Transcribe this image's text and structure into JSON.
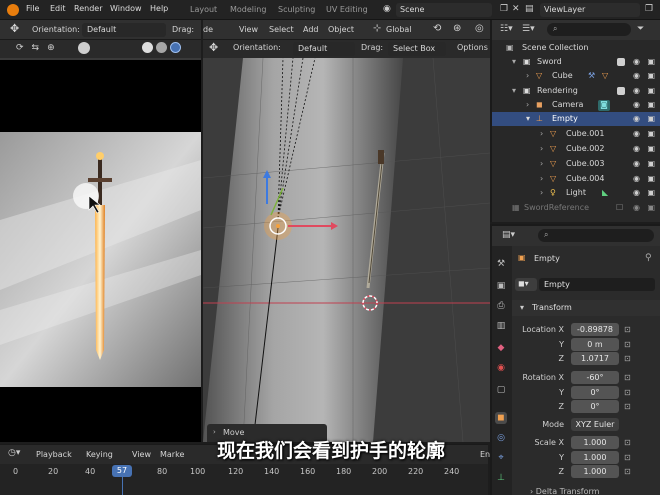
{
  "menu": {
    "file": "File",
    "edit": "Edit",
    "render": "Render",
    "window": "Window",
    "help": "Help"
  },
  "workspace_tabs": {
    "layout": "Layout",
    "modeling": "Modeling",
    "sculpting": "Sculpting",
    "uv_editing": "UV Editing"
  },
  "scene_field": "Scene",
  "view_layer_field": "ViewLayer",
  "left_viewport": {
    "orientation_label": "Orientation:",
    "orientation_value": "Default",
    "drag_label": "Drag:",
    "drag_value_partial": "Se"
  },
  "main_viewport": {
    "mode_partial": "de",
    "view": "View",
    "select": "Select",
    "add": "Add",
    "object": "Object",
    "transform_orientation": "Global",
    "orientation_label": "Orientation:",
    "orientation_value": "Default",
    "drag_label": "Drag:",
    "drag_value": "Select Box",
    "options": "Options",
    "move_panel": "Move"
  },
  "outliner": {
    "items": [
      {
        "label": "Scene Collection"
      },
      {
        "label": "Sword"
      },
      {
        "label": "Cube"
      },
      {
        "label": "Rendering"
      },
      {
        "label": "Camera"
      },
      {
        "label": "Empty"
      },
      {
        "label": "Cube.001"
      },
      {
        "label": "Cube.002"
      },
      {
        "label": "Cube.003"
      },
      {
        "label": "Cube.004"
      },
      {
        "label": "Light"
      },
      {
        "label": "SwordReference"
      }
    ]
  },
  "properties": {
    "object_name_header": "Empty",
    "object_name_field": "Empty",
    "transform_title": "Transform",
    "location_label": "Location X",
    "location": [
      "-0.89878",
      "0 m",
      "1.0717"
    ],
    "rotation_label": "Rotation X",
    "rotation": [
      "-60°",
      "0°",
      "0°"
    ],
    "y_label": "Y",
    "z_label": "Z",
    "mode_label": "Mode",
    "mode_value": "XYZ Euler",
    "scale_label": "Scale X",
    "scale": [
      "1.000",
      "1.000",
      "1.000"
    ],
    "delta_transform": "Delta Transform"
  },
  "timeline": {
    "playback": "Playback",
    "keying": "Keying",
    "view": "View",
    "marker_partial": "Marke",
    "end_partial": "En",
    "current_frame": "57",
    "ticks": [
      "0",
      "20",
      "40",
      "80",
      "100",
      "120",
      "140",
      "160",
      "180",
      "200",
      "220",
      "240"
    ]
  },
  "subtitle": "现在我们会看到护手的轮廓",
  "colors": {
    "accent_blue": "#4772b3",
    "selected_row": "#334d80",
    "orange_origin": "#f5a13c",
    "x_axis_red": "#e04a5f",
    "y_axis_green": "#7db33c",
    "z_axis_blue": "#3d7ae0"
  }
}
